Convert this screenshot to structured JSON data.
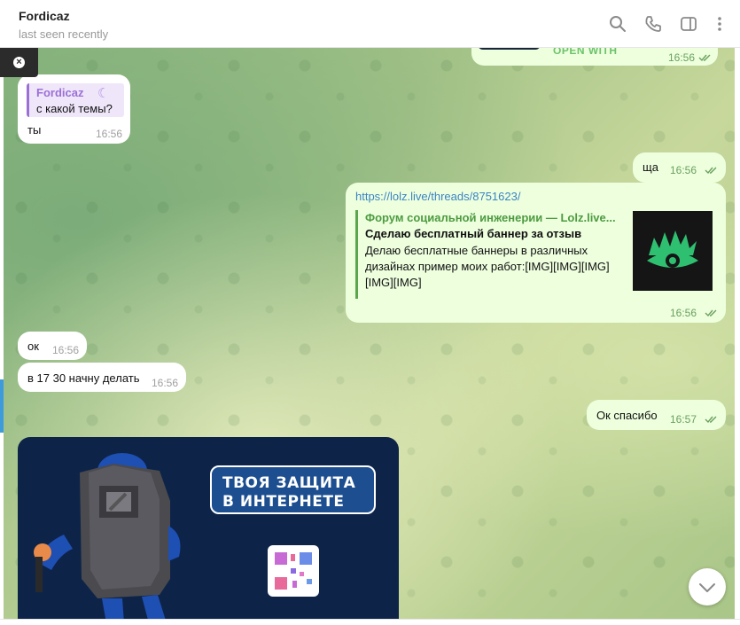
{
  "header": {
    "title": "Fordicaz",
    "status": "last seen recently",
    "icons": [
      "search-icon",
      "phone-icon",
      "sidebar-toggle-icon",
      "more-vertical-icon"
    ]
  },
  "messages": {
    "top_partial": {
      "text": "OPEN WITH",
      "time": "16:56"
    },
    "reply_msg": {
      "reply_name": "Fordicaz",
      "reply_text": "с какой темы?",
      "text": "ты",
      "time": "16:56"
    },
    "out_sha": {
      "text": "ща",
      "time": "16:56"
    },
    "link_msg": {
      "url": "https://lolz.live/threads/8751623/",
      "site": "Форум социальной инженерии — Lolz.live...",
      "title": "Сделаю бесплатный баннер за отзыв",
      "description": "Делаю бесплатные баннеры в различных дизайнах пример моих работ:[IMG][IMG][IMG][IMG][IMG]",
      "time": "16:56"
    },
    "in_ok": {
      "text": "ок",
      "time": "16:56"
    },
    "in_start": {
      "text": "в 17 30 начну делать",
      "time": "16:56"
    },
    "out_thanks": {
      "text": "Ок спасибо",
      "time": "16:57"
    },
    "media": {
      "banner_text": "ТВОЯ ЗАЩИТА В ИНТЕРНЕТЕ"
    }
  },
  "colors": {
    "outgoing_bubble": "#eeffde",
    "incoming_bubble": "#ffffff",
    "link": "#3b84c4",
    "preview_accent": "#59a64d",
    "reply_accent": "#9c6fd6"
  }
}
